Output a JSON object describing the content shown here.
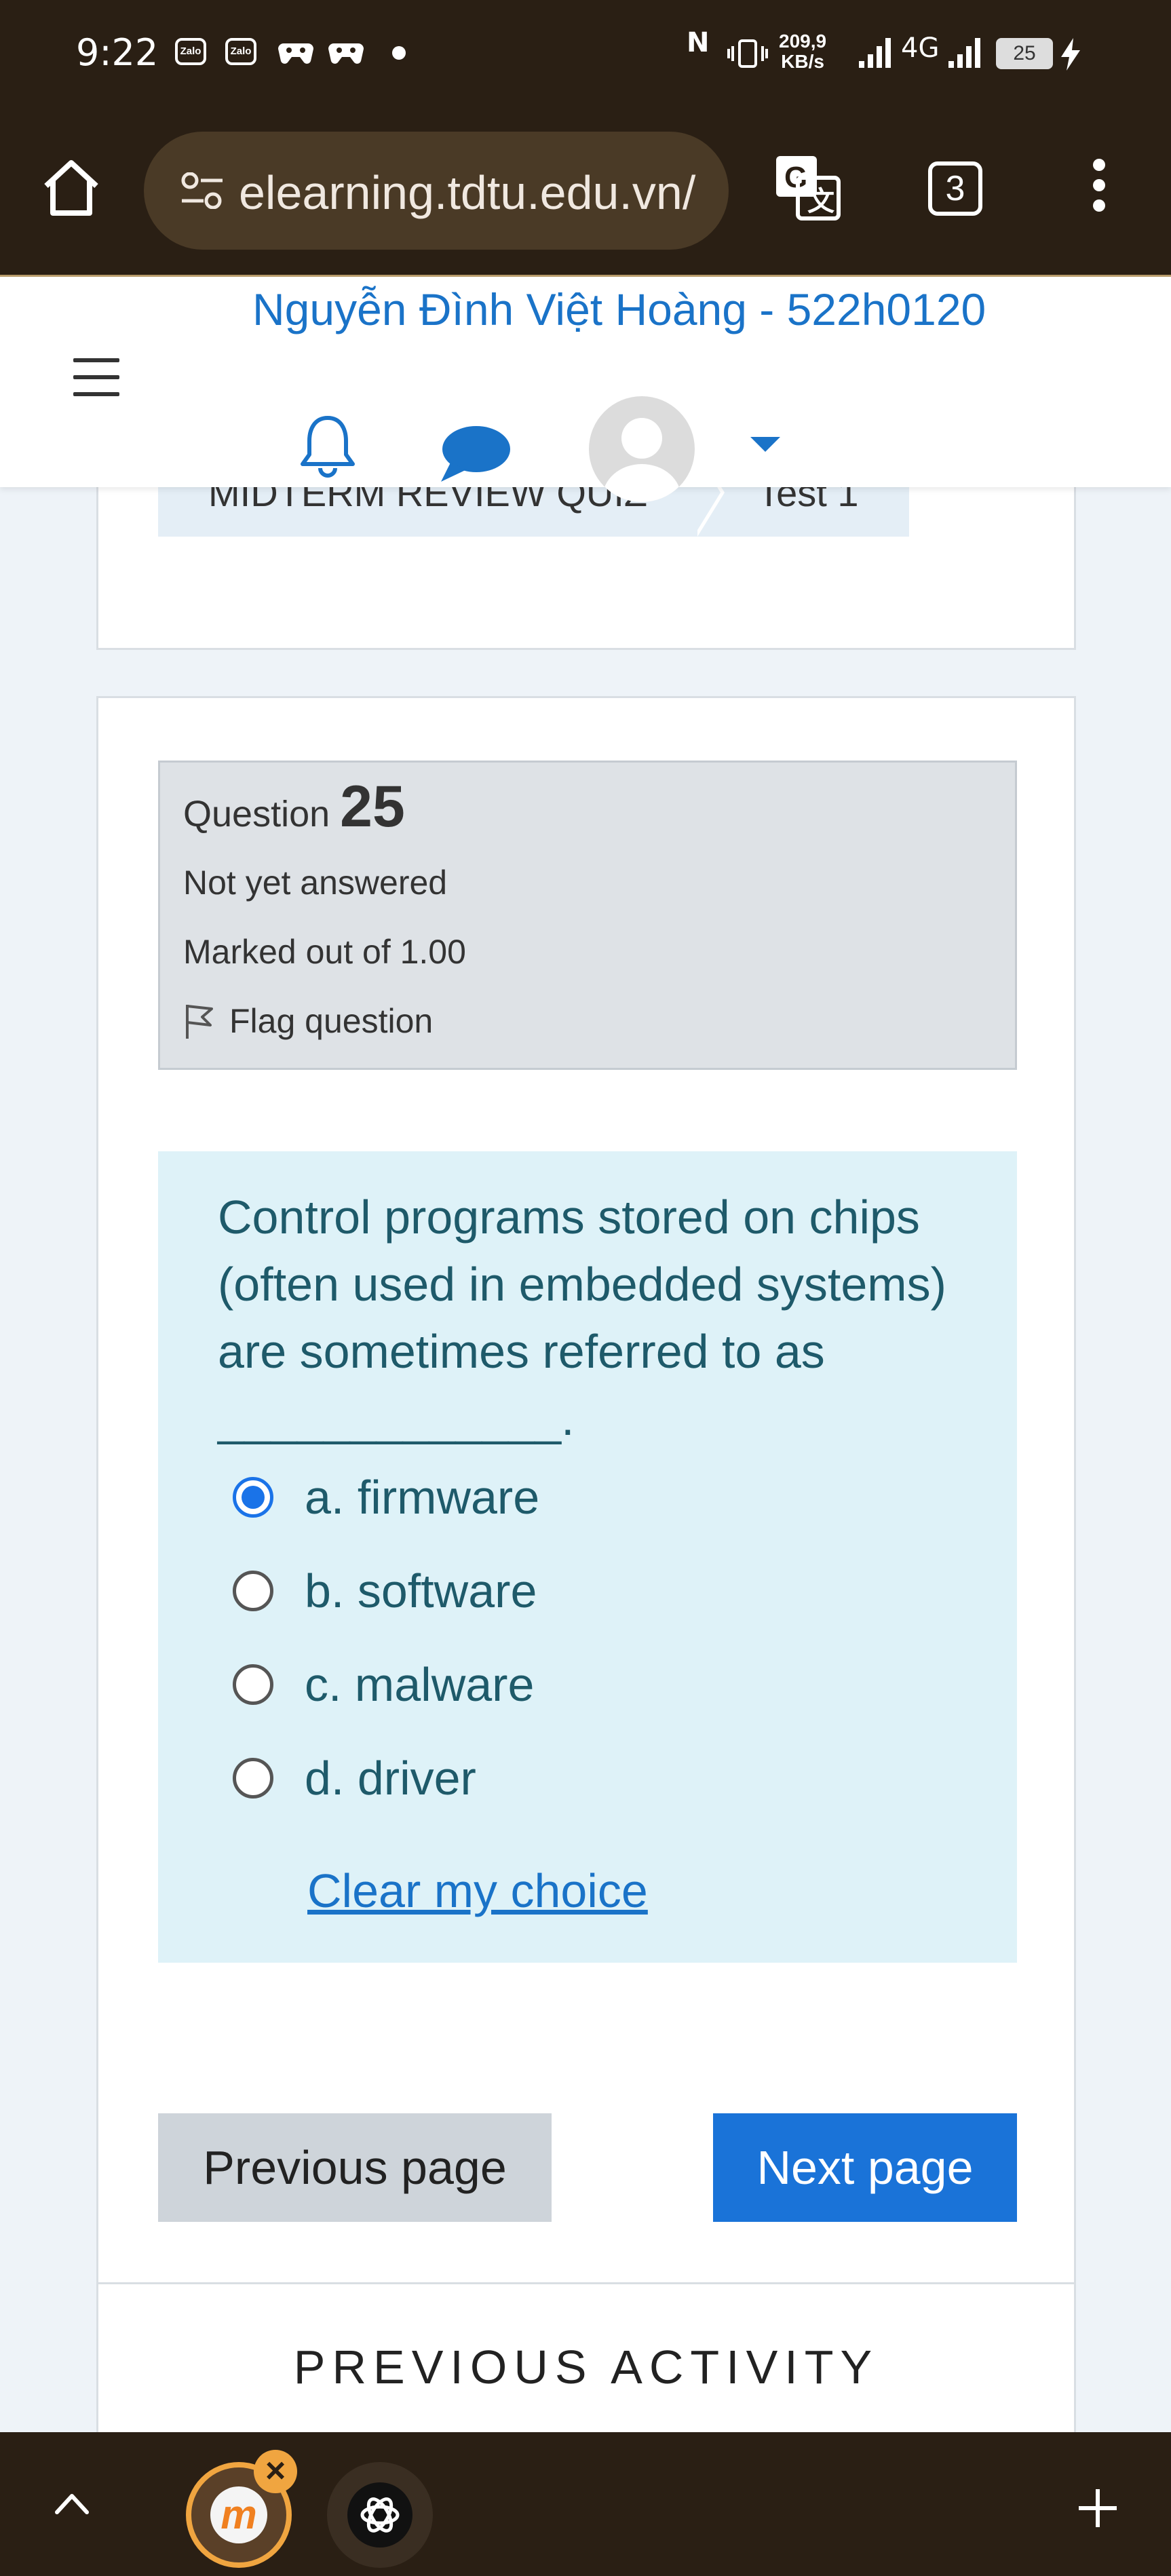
{
  "status_bar": {
    "time": "9:22",
    "zalo_1": "Zalo",
    "zalo_2": "Zalo",
    "nfc": "N",
    "speed_value": "209,9",
    "speed_unit": "KB/s",
    "network": "4G",
    "battery": "25"
  },
  "browser": {
    "url": "elearning.tdtu.edu.vn/",
    "tab_count": "3"
  },
  "navbar": {
    "user_name": "Nguyễn Đình Việt Hoàng - 522h0120"
  },
  "breadcrumb": {
    "items": [
      "MIDTERM REVIEW QUIZ",
      "Test 1"
    ]
  },
  "question": {
    "label": "Question",
    "number": "25",
    "status": "Not yet answered",
    "marks": "Marked out of 1.00",
    "flag_label": "Flag question",
    "text": "Control programs stored on chips (often used in embedded systems) are sometimes referred to as _____________.",
    "answers": [
      {
        "label": "a. firmware",
        "selected": true
      },
      {
        "label": "b. software",
        "selected": false
      },
      {
        "label": "c. malware",
        "selected": false
      },
      {
        "label": "d. driver",
        "selected": false
      }
    ],
    "clear_choice": "Clear my choice"
  },
  "navigation": {
    "previous": "Previous page",
    "next": "Next page"
  },
  "footer": {
    "previous_activity": "PREVIOUS ACTIVITY"
  },
  "bottom_bar": {
    "moodle_letter": "m",
    "close_symbol": "×"
  },
  "colors": {
    "accent": "#1a73d8",
    "link": "#1a73c8",
    "question_bg": "#def2f8",
    "info_bg": "#dee2e6"
  }
}
